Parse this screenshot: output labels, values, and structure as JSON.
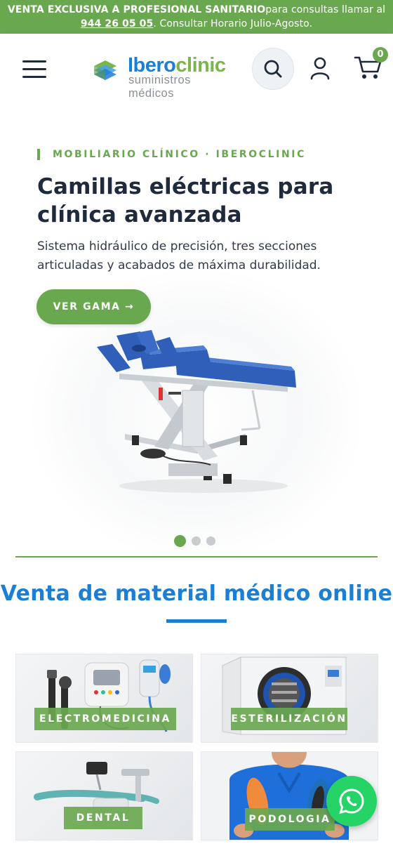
{
  "topbar": {
    "bold_text": "VENTA EXCLUSIVA A PROFESIONAL SANITARIO",
    "text_before_phone": "para consultas llamar al ",
    "phone": "944 26 05 05",
    "text_after_phone": ". Consultar Horario Julio-Agosto."
  },
  "header": {
    "logo_name_part1": "Ibero",
    "logo_name_part2": "clinic",
    "logo_subtitle": "suministros médicos",
    "cart_count": "0",
    "icons": {
      "menu": "hamburger-menu-icon",
      "search": "search-icon",
      "user": "user-icon",
      "cart": "cart-icon"
    }
  },
  "hero": {
    "kicker": "MOBILIARIO CLÍNICO · IBEROCLINIC",
    "title": "Camillas eléctricas para clínica avanzada",
    "description": "Sistema hidráulico de precisión, tres secciones articuladas y acabados de máxima durabilidad.",
    "cta_label": "VER GAMA →",
    "slides_total": 3,
    "active_slide": 1
  },
  "section": {
    "title": "Venta de material médico online"
  },
  "categories": [
    {
      "label": "ELECTROMEDICINA"
    },
    {
      "label": "ESTERILIZACIÓN"
    },
    {
      "label": "DENTAL"
    },
    {
      "label": "PODOLOGIA"
    }
  ],
  "colors": {
    "brand_green": "#6aa84f",
    "brand_blue": "#1c7fd6",
    "dark_text": "#1f2a3c",
    "whatsapp": "#25d366"
  },
  "whatsapp": {
    "icon": "whatsapp-icon"
  }
}
